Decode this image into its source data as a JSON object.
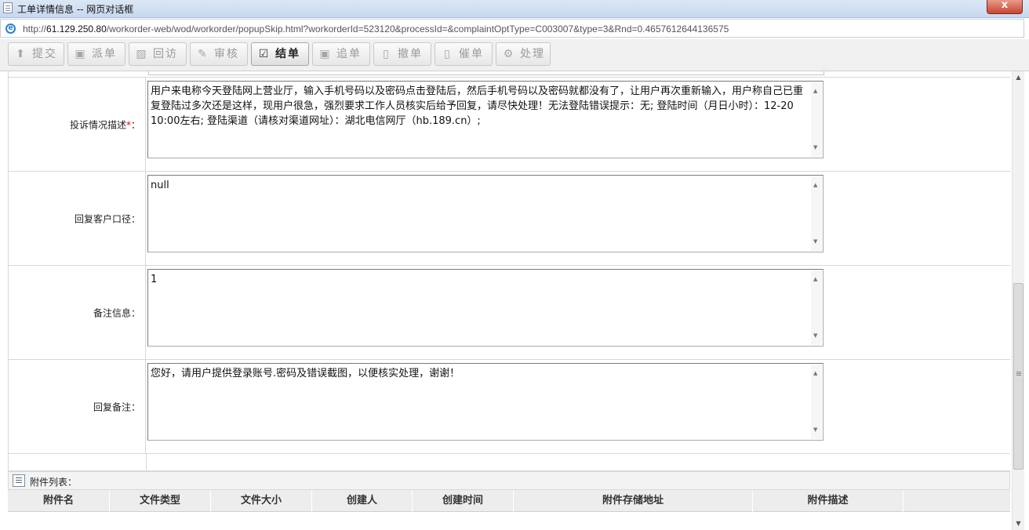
{
  "window": {
    "title": "工单详情信息 -- 网页对话框",
    "close_label": "x"
  },
  "address": {
    "scheme": "http://",
    "host": "61.129.250.80",
    "path": "/workorder-web/wod/workorder/popupSkip.html?workorderId=523120&processId=&complaintOptType=C003007&type=3&Rnd=0.4657612644136575"
  },
  "toolbar": {
    "buttons": [
      {
        "label": "提交",
        "icon": "submit-icon"
      },
      {
        "label": "派单",
        "icon": "dispatch-icon"
      },
      {
        "label": "回访",
        "icon": "return-visit-icon"
      },
      {
        "label": "审核",
        "icon": "review-icon"
      },
      {
        "label": "结单",
        "icon": "close-order-icon"
      },
      {
        "label": "追单",
        "icon": "follow-up-icon"
      },
      {
        "label": "撤单",
        "icon": "withdraw-icon"
      },
      {
        "label": "催单",
        "icon": "urge-icon"
      },
      {
        "label": "处理",
        "icon": "process-icon"
      }
    ]
  },
  "form": {
    "complaint": {
      "label": "投诉情况描述",
      "required_mark": "*",
      "colon": "：",
      "value": "用户来电称今天登陆网上营业厅，输入手机号码以及密码点击登陆后，然后手机号码以及密码就都没有了，让用户再次重新输入，用户称自己已重复登陆过多次还是这样，现用户很急，强烈要求工作人员核实后给予回复，请尽快处理！无法登陆错误提示：无;      登陆时间（月日小时）：12-20  10:00左右;      登陆渠道（请核对渠道网址）：湖北电信网厅（hb.189.cn）;"
    },
    "reply_caliber": {
      "label": "回复客户口径：",
      "value": "null"
    },
    "remark": {
      "label": "备注信息：",
      "value": "1"
    },
    "reply_remark": {
      "label": "回复备注：",
      "value": "您好，请用户提供登录账号.密码及错误截图，以便核实处理，谢谢！"
    }
  },
  "attachments": {
    "title": "附件列表：",
    "columns": [
      "附件名",
      "文件类型",
      "文件大小",
      "创建人",
      "创建时间",
      "附件存储地址",
      "附件描述"
    ]
  }
}
